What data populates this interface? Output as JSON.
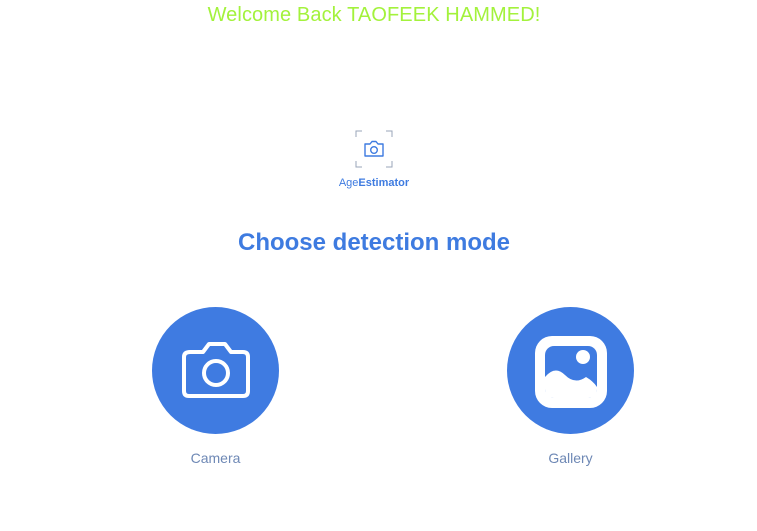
{
  "header": {
    "welcome_text": "Welcome Back TAOFEEK HAMMED!"
  },
  "logo": {
    "name_light": "Age",
    "name_bold": "Estimator",
    "icon": "camera-viewfinder-icon"
  },
  "main": {
    "heading": "Choose detection mode",
    "modes": [
      {
        "label": "Camera",
        "icon": "camera-icon"
      },
      {
        "label": "Gallery",
        "icon": "image-icon"
      }
    ]
  },
  "colors": {
    "welcome": "#a3f23c",
    "accent": "#3f7be1",
    "label": "#6e88b5",
    "background": "#ffffff"
  }
}
